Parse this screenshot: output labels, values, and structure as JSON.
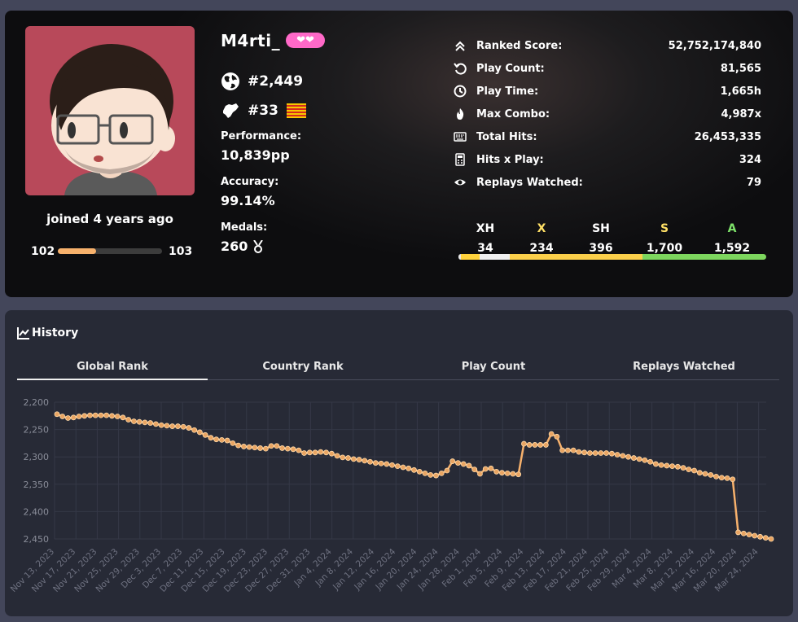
{
  "profile": {
    "username": "M4rti_",
    "supporter_badge": "❤❤",
    "joined": "joined 4 years ago",
    "level_current": "102",
    "level_next": "103",
    "level_progress": 0.37,
    "global_rank": "#2,449",
    "country_rank": "#33",
    "performance_label": "Performance:",
    "performance_value": "10,839pp",
    "accuracy_label": "Accuracy:",
    "accuracy_value": "99.14%",
    "medals_label": "Medals:",
    "medals_value": "260"
  },
  "stats": [
    {
      "icon": "chevrons-up-icon",
      "label": "Ranked Score:",
      "value": "52,752,174,840"
    },
    {
      "icon": "replay-icon",
      "label": "Play Count:",
      "value": "81,565"
    },
    {
      "icon": "clock-icon",
      "label": "Play Time:",
      "value": "1,665h"
    },
    {
      "icon": "flame-icon",
      "label": "Max Combo:",
      "value": "4,987x"
    },
    {
      "icon": "keyboard-icon",
      "label": "Total Hits:",
      "value": "26,453,335"
    },
    {
      "icon": "calculator-icon",
      "label": "Hits x Play:",
      "value": "324"
    },
    {
      "icon": "eye-icon",
      "label": "Replays Watched:",
      "value": "79"
    }
  ],
  "grades": [
    {
      "label": "XH",
      "value": "34",
      "count": 34,
      "color": "#ffffff",
      "bar_color": "#e8e8e8"
    },
    {
      "label": "X",
      "value": "234",
      "count": 234,
      "color": "#ffe066",
      "bar_color": "#ffd23c"
    },
    {
      "label": "SH",
      "value": "396",
      "count": 396,
      "color": "#ffffff",
      "bar_color": "#f0f0f0"
    },
    {
      "label": "S",
      "value": "1,700",
      "count": 1700,
      "color": "#ffe066",
      "bar_color": "#fbcf4a"
    },
    {
      "label": "A",
      "value": "1,592",
      "count": 1592,
      "color": "#7ee36a",
      "bar_color": "#7dd65e"
    }
  ],
  "history": {
    "title": "History",
    "tabs": [
      "Global Rank",
      "Country Rank",
      "Play Count",
      "Replays Watched"
    ],
    "active_tab": 0
  },
  "chart_data": {
    "type": "line",
    "title": "",
    "xlabel": "",
    "ylabel": "",
    "y_inverted": true,
    "ylim": [
      2200,
      2450
    ],
    "yticks": [
      "2,200",
      "2,250",
      "2,300",
      "2,350",
      "2,400",
      "2,450"
    ],
    "xticks": [
      "Nov 13, 2023",
      "Nov 17, 2023",
      "Nov 21, 2023",
      "Nov 25, 2023",
      "Nov 29, 2023",
      "Dec 3, 2023",
      "Dec 7, 2023",
      "Dec 11, 2023",
      "Dec 15, 2023",
      "Dec 19, 2023",
      "Dec 23, 2023",
      "Dec 27, 2023",
      "Dec 31, 2023",
      "Jan 4, 2024",
      "Jan 8, 2024",
      "Jan 12, 2024",
      "Jan 16, 2024",
      "Jan 20, 2024",
      "Jan 24, 2024",
      "Jan 28, 2024",
      "Feb 1, 2024",
      "Feb 5, 2024",
      "Feb 9, 2024",
      "Feb 13, 2024",
      "Feb 17, 2024",
      "Feb 21, 2024",
      "Feb 25, 2024",
      "Feb 29, 2024",
      "Mar 4, 2024",
      "Mar 8, 2024",
      "Mar 12, 2024",
      "Mar 16, 2024",
      "Mar 20, 2024",
      "Mar 24, 2024"
    ],
    "series": [
      {
        "name": "",
        "color": "#f7b16c",
        "values": [
          2222,
          2226,
          2229,
          2228,
          2226,
          2225,
          2224,
          2224,
          2224,
          2224,
          2225,
          2226,
          2228,
          2232,
          2235,
          2236,
          2237,
          2238,
          2240,
          2242,
          2243,
          2244,
          2244,
          2245,
          2247,
          2251,
          2255,
          2260,
          2265,
          2268,
          2269,
          2270,
          2275,
          2279,
          2281,
          2282,
          2283,
          2284,
          2285,
          2280,
          2280,
          2284,
          2285,
          2286,
          2288,
          2293,
          2292,
          2292,
          2291,
          2292,
          2294,
          2298,
          2301,
          2302,
          2304,
          2305,
          2307,
          2309,
          2311,
          2312,
          2313,
          2315,
          2317,
          2319,
          2321,
          2324,
          2327,
          2330,
          2333,
          2334,
          2330,
          2325,
          2308,
          2311,
          2313,
          2316,
          2323,
          2331,
          2322,
          2321,
          2327,
          2329,
          2330,
          2331,
          2332,
          2276,
          2278,
          2278,
          2278,
          2278,
          2258,
          2263,
          2288,
          2288,
          2288,
          2291,
          2292,
          2293,
          2293,
          2293,
          2293,
          2294,
          2296,
          2298,
          2300,
          2302,
          2304,
          2306,
          2309,
          2313,
          2315,
          2316,
          2317,
          2318,
          2320,
          2323,
          2325,
          2329,
          2331,
          2333,
          2336,
          2338,
          2339,
          2341,
          2438,
          2440,
          2442,
          2444,
          2446,
          2448,
          2450
        ]
      }
    ]
  }
}
